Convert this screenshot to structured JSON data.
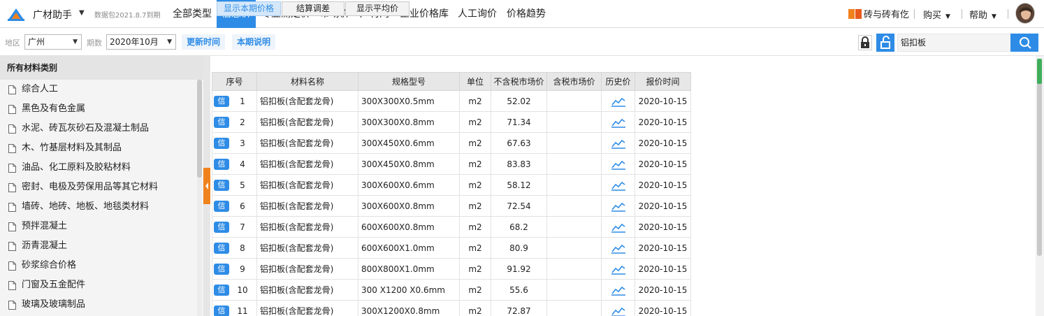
{
  "app": {
    "name": "广材助手",
    "package_info": "数据包2021.8.7到期"
  },
  "nav": {
    "items": [
      "全部类型",
      "信息价",
      "专业测定价",
      "市场价",
      "广材网",
      "企业价格库",
      "人工询价",
      "价格趋势"
    ],
    "active": "信息价"
  },
  "top_right": {
    "promo": "砖与砖有仡",
    "buy": "购买",
    "help": "帮助"
  },
  "filters": {
    "region_label": "地区",
    "region_value": "广州",
    "period_label": "期数",
    "period_value": "2020年10月",
    "update_time_btn": "更新时间",
    "period_note_btn": "本期说明"
  },
  "search": {
    "value": "铝扣板"
  },
  "sidebar": {
    "title": "所有材料类别",
    "items": [
      "综合人工",
      "黑色及有色金属",
      "水泥、砖瓦灰砂石及混凝土制品",
      "木、竹基层材料及其制品",
      "油品、化工原料及胶粘材料",
      "密封、电极及劳保用品等其它材料",
      "墙砖、地砖、地板、地毯类材料",
      "预拌混凝土",
      "沥青混凝土",
      "砂浆综合价格",
      "门窗及五金配件",
      "玻璃及玻璃制品"
    ]
  },
  "tabs": [
    "显示本期价格",
    "结算调差",
    "显示平均价"
  ],
  "table": {
    "headers": [
      "序号",
      "材料名称",
      "规格型号",
      "单位",
      "不含税市场价",
      "含税市场价",
      "历史价",
      "报价时间"
    ],
    "badge": "信",
    "rows": [
      {
        "no": "1",
        "name": "铝扣板(含配套龙骨)",
        "spec": "300X300X0.5mm",
        "unit": "m2",
        "price": "52.02",
        "tax_price": "",
        "date": "2020-10-15"
      },
      {
        "no": "2",
        "name": "铝扣板(含配套龙骨)",
        "spec": "300X300X0.8mm",
        "unit": "m2",
        "price": "71.34",
        "tax_price": "",
        "date": "2020-10-15"
      },
      {
        "no": "3",
        "name": "铝扣板(含配套龙骨)",
        "spec": "300X450X0.6mm",
        "unit": "m2",
        "price": "67.63",
        "tax_price": "",
        "date": "2020-10-15"
      },
      {
        "no": "4",
        "name": "铝扣板(含配套龙骨)",
        "spec": "300X450X0.8mm",
        "unit": "m2",
        "price": "83.83",
        "tax_price": "",
        "date": "2020-10-15"
      },
      {
        "no": "5",
        "name": "铝扣板(含配套龙骨)",
        "spec": "300X600X0.6mm",
        "unit": "m2",
        "price": "58.12",
        "tax_price": "",
        "date": "2020-10-15"
      },
      {
        "no": "6",
        "name": "铝扣板(含配套龙骨)",
        "spec": "300X600X0.8mm",
        "unit": "m2",
        "price": "72.54",
        "tax_price": "",
        "date": "2020-10-15"
      },
      {
        "no": "7",
        "name": "铝扣板(含配套龙骨)",
        "spec": "600X600X0.8mm",
        "unit": "m2",
        "price": "68.2",
        "tax_price": "",
        "date": "2020-10-15"
      },
      {
        "no": "8",
        "name": "铝扣板(含配套龙骨)",
        "spec": "600X600X1.0mm",
        "unit": "m2",
        "price": "80.9",
        "tax_price": "",
        "date": "2020-10-15"
      },
      {
        "no": "9",
        "name": "铝扣板(含配套龙骨)",
        "spec": "800X800X1.0mm",
        "unit": "m2",
        "price": "91.92",
        "tax_price": "",
        "date": "2020-10-15"
      },
      {
        "no": "10",
        "name": "铝扣板(含配套龙骨)",
        "spec": "300 X1200 X0.6mm",
        "unit": "m2",
        "price": "55.6",
        "tax_price": "",
        "date": "2020-10-15"
      },
      {
        "no": "11",
        "name": "铝扣板(含配套龙骨)",
        "spec": "300X1200X0.8mm",
        "unit": "m2",
        "price": "72.87",
        "tax_price": "",
        "date": "2020-10-15"
      }
    ]
  },
  "colors": {
    "accent": "#2e8ce6",
    "handle": "#f0821e"
  }
}
